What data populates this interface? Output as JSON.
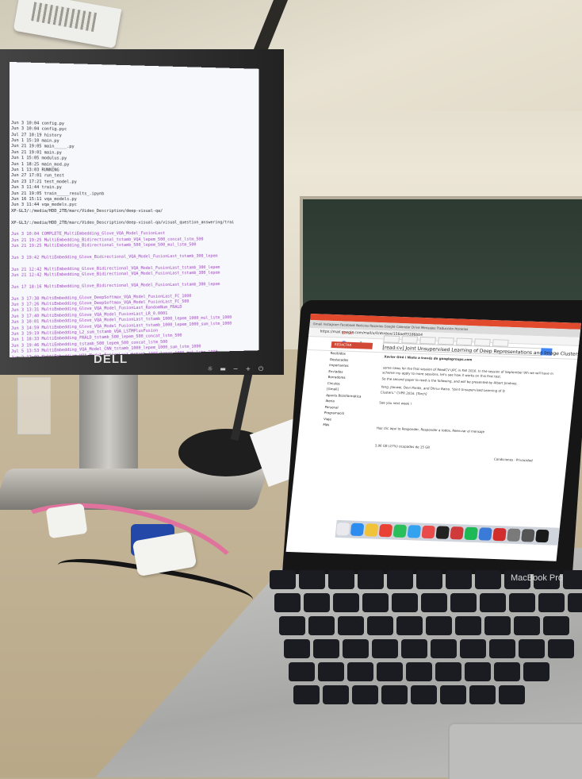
{
  "monitor": {
    "brand": "DELL",
    "terminal_lines": [
      {
        "text": "",
        "color": "black"
      },
      {
        "text": "",
        "color": "purple"
      },
      {
        "text": "",
        "color": "purple"
      },
      {
        "text": "",
        "color": "black"
      },
      {
        "text": "",
        "color": "black"
      },
      {
        "text": "",
        "color": "purple"
      },
      {
        "text": "",
        "color": "black"
      },
      {
        "text": "",
        "color": "purple"
      },
      {
        "text": "",
        "color": "purple"
      },
      {
        "text": "",
        "color": "black"
      },
      {
        "text": "Jun  3 10:04 config.py",
        "color": "black"
      },
      {
        "text": "Jun  3 10:04 config.pyc",
        "color": "black"
      },
      {
        "text": "Jul 27 10:19 history",
        "color": "black"
      },
      {
        "text": "Jun  1 15:10 main.py",
        "color": "black"
      },
      {
        "text": "Jun 21 19:05 main_____.py",
        "color": "black"
      },
      {
        "text": "Jun 21 19:01 main.py",
        "color": "black"
      },
      {
        "text": "Jun  1 15:05 modulus.py",
        "color": "black"
      },
      {
        "text": "Jun  1 18:25 main_mod.py",
        "color": "black"
      },
      {
        "text": "Jun  1 13:03 RUNNING",
        "color": "black"
      },
      {
        "text": "Jun 27 17:01 run_test",
        "color": "black"
      },
      {
        "text": "Jun 23 17:21 test_model.py",
        "color": "black"
      },
      {
        "text": "Jun  3 11:44 train.py",
        "color": "black"
      },
      {
        "text": "Jun 21 19:05 train_____results_.ipynb",
        "color": "black"
      },
      {
        "text": "Jun 16 15:11 vqa_models.py",
        "color": "black"
      },
      {
        "text": "Jun  3 11:44 vqa_models.pyc",
        "color": "black"
      },
      {
        "text": "XP-GL3/:/media/HDD_2TB/marc/Video_Description/deep-visual-qa/",
        "color": "black"
      },
      {
        "text": "",
        "color": "black"
      },
      {
        "text": "XP-GL3/:/media/HDD_2TB/marc/Video_Description/deep-visual-qa/visual_question_answering/trai",
        "color": "black"
      },
      {
        "text": "",
        "color": "black"
      },
      {
        "text": "Jun  3 10:04 COMPLETE_MultiEmbedding_Glove_VQA_Model_FusionLast",
        "color": "purple"
      },
      {
        "text": "Jun 21 19:25 MultiEmbedding_Bidirectional_tstamb_VQA_lepem_500_concat_lstm_500",
        "color": "purple"
      },
      {
        "text": "Jun 21 19:25 MultiEmbedding_Bidirectional_tstamb_500_lepem_500_mul_lstm_500",
        "color": "purple"
      },
      {
        "text": "",
        "color": "purple"
      },
      {
        "text": "Jun  3 19:42 MultiEmbedding_Glove_Bidirectional_VQA_Model_FusionLast_tstamb_300_lepem",
        "color": "purple"
      },
      {
        "text": "",
        "color": "purple"
      },
      {
        "text": "Jun 21 12:42 MultiEmbedding_Glove_Bidirectional_VQA_Model_FusionLast_tstamb_300_lepem",
        "color": "purple"
      },
      {
        "text": "Jun 21 12:42 MultiEmbedding_Glove_Bidirectional_VQA_Model_FusionLast_tstamb_300_lepem",
        "color": "purple"
      },
      {
        "text": "",
        "color": "purple"
      },
      {
        "text": "Jun 17 18:16 MultiEmbedding_Glove_Bidirectional_VQA_Model_FusionLast_tstamb_300_lepem",
        "color": "purple"
      },
      {
        "text": "",
        "color": "purple"
      },
      {
        "text": "Jun  3 17:38 MultiEmbedding_Glove_DeepSoftmax_VQA_Model_FusionLast_FC_1000",
        "color": "purple"
      },
      {
        "text": "Jun  3 17:26 MultiEmbedding_Glove_DeepSoftmax_VQA_Model_FusionLast_FC_500",
        "color": "purple"
      },
      {
        "text": "Jun  3 13:31 MultiEmbedding_Glove_VQA_Model_FusionLast_RandomNum_FRALD",
        "color": "purple"
      },
      {
        "text": "Jun  3 17:40 MultiEmbedding_Glove_VQA_Model_FusionLast_LR_0.0001",
        "color": "purple"
      },
      {
        "text": "Jun  3 10:01 MultiEmbedding_Glove_VQA_Model_FusionLast_tstamb_1000_lepem_1000_mul_lstm_1000",
        "color": "purple"
      },
      {
        "text": "Jun  3 14:59 MultiEmbedding_Glove_VQA_Model_FusionLast_tstamb_1000_lepem_1000_sum_lstm_1000",
        "color": "purple"
      },
      {
        "text": "Jun  3 19:19 MultiEmbedding_L2_sum_tstamb_VQA_LSTMPlusFusion",
        "color": "purple"
      },
      {
        "text": "Jun  1 18:33 MultiEmbedding_FRALD_tstamb_500_lepem_500_concat_lstm_500",
        "color": "purple"
      },
      {
        "text": "Jun  3 19:46 MultiEmbedding_tstamb_500_lepem_500_concat_lstm_500",
        "color": "purple"
      },
      {
        "text": "Jul  5 13:53 MultiEmbedding_VQA_Model_CNN_tstamb_1000_lepem_1000_sum_lstm_1000",
        "color": "purple"
      },
      {
        "text": "Jun  2 17:09 MultiEmbedding_VQA_Model_FusionLast_tstamb_1000_lepem_1000_mul_lstm_1000",
        "color": "purple"
      },
      {
        "text": "XP-GL3/:/media/HDD_2TB/marc/Video_Description/deep-visual-qa/visual_question_answering/trai",
        "color": "black"
      }
    ],
    "buttons": [
      "☼",
      "▬",
      "−",
      "+",
      "⏻"
    ]
  },
  "laptop": {
    "brand": "MacBook Pro",
    "tabs_text": "Gmail   Instagram   Facebook   Notícies   Rosarios   Google Calendar   Drive   Mensajes   Traducción   Horarios",
    "url": "https://mail.google.com/mail/u/0/#inbox/156aeff3186bb4",
    "gmail": {
      "logo": "Google",
      "label": "Gmail",
      "compose": "REDACTAR",
      "nav": [
        "Recibidos",
        "Destacados",
        "Importantes",
        "Enviados",
        "Borradores",
        "Círculos",
        "[Gmail]",
        "Apunts Bioinformàtica",
        "Iberia",
        "Personal",
        "Programació",
        "Viaje",
        "Más"
      ],
      "subject": "[read:cv] Joint Unsupervised Learning of Deep Representations and Image Clusters",
      "from": "Xavier Giró i Nieto a través de googlegroups.com",
      "body": [
        "some news for the first session of ReadCV UPC in Fall 2016. In the session of September 9th we will have m",
        "scheme my apply to more sessions, let's see how it works on this first test.",
        "So the second paper to read is the following, and will be presented by Albert Jiménez.",
        "Yang, Jianwei, Devi Parikh, and Dhruv Batra. \"Joint Unsupervised Learning of D",
        "Clusters.\" CVPR 2016. [Torch]",
        "See you next week !",
        "Haz clic aquí to Responder, Responder a todos, Reenviar el mensaje",
        "3,96 GB (27%) ocupados de 15 GB",
        "Condiciones · Privacidad"
      ]
    },
    "dock_colors": [
      "#e9e9ee",
      "#2d8cf0",
      "#f1c338",
      "#e94235",
      "#2bbf5b",
      "#33a3f0",
      "#e94b4b",
      "#222222",
      "#d13a3a",
      "#1db954",
      "#3b7bd8",
      "#d12d2d",
      "#7a7a7a",
      "#555555",
      "#1a1a1a"
    ]
  }
}
